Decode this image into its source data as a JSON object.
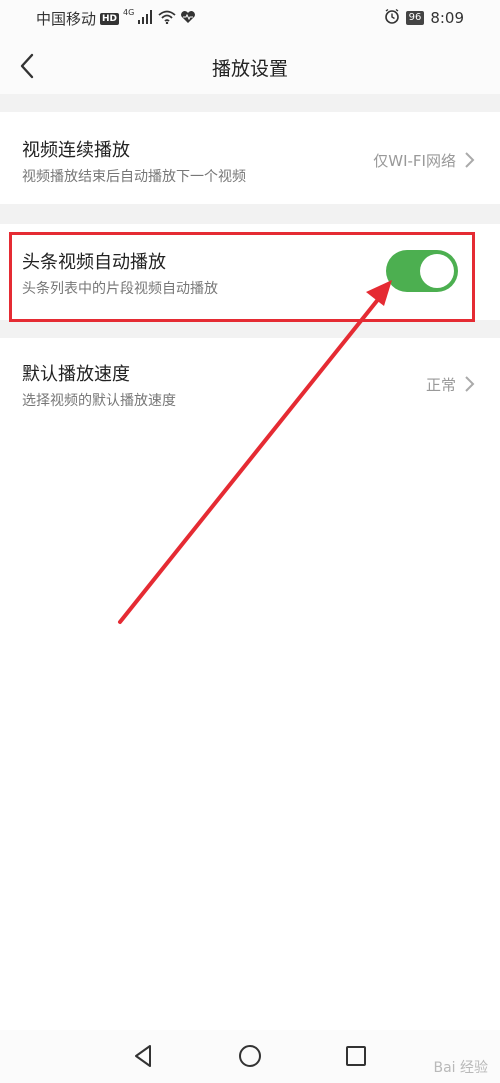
{
  "status_bar": {
    "carrier": "中国移动",
    "hd": "HD",
    "signal_label": "4G",
    "battery": "96",
    "time": "8:09",
    "icons": [
      "signal-icon",
      "wifi-icon",
      "heart-icon",
      "alarm-icon"
    ]
  },
  "header": {
    "title": "播放设置",
    "back_icon": "back-chevron-icon"
  },
  "settings": [
    {
      "title": "视频连续播放",
      "subtitle": "视频播放结束后自动播放下一个视频",
      "value": "仅WI-FI网络"
    },
    {
      "title": "头条视频自动播放",
      "subtitle": "头条列表中的片段视频自动播放",
      "toggle_on": true
    },
    {
      "title": "默认播放速度",
      "subtitle": "选择视频的默认播放速度",
      "value": "正常"
    }
  ],
  "annotation": {
    "highlight_color": "#e52b33"
  },
  "navbar": {
    "icons": [
      "back-triangle-icon",
      "home-circle-icon",
      "recents-square-icon"
    ]
  },
  "watermark": "Bai 经验",
  "colors": {
    "toggle_on": "#4caf50",
    "accent_red": "#e52b33"
  }
}
